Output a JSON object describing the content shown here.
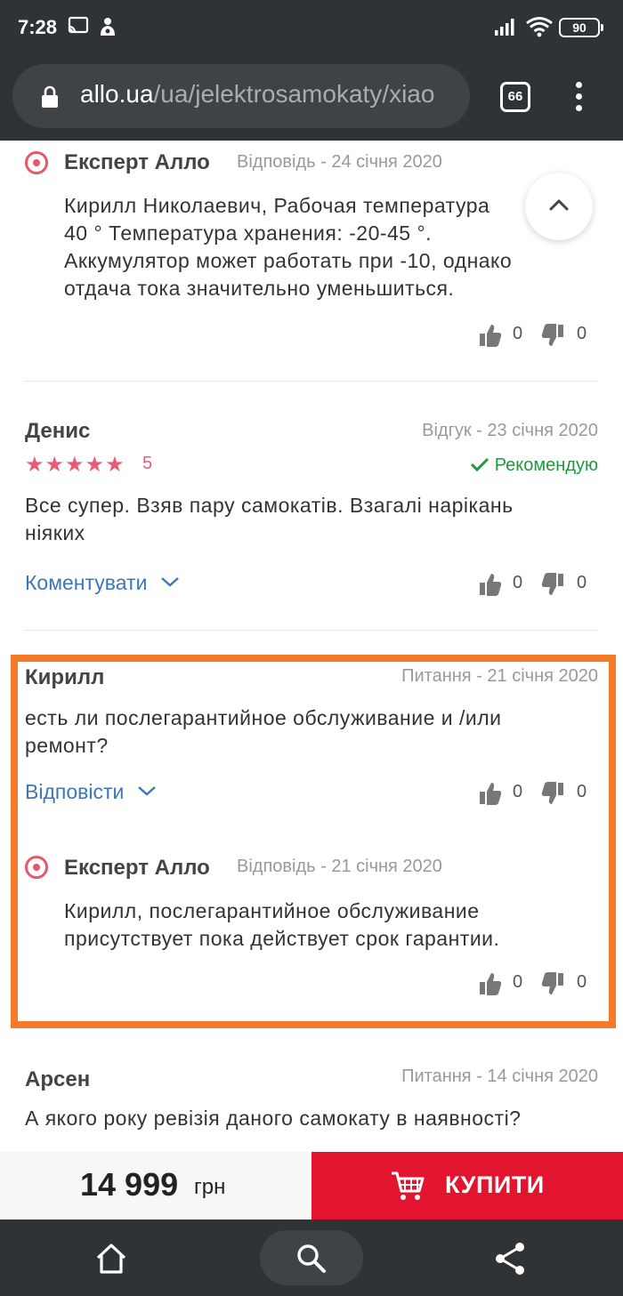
{
  "status_bar": {
    "time": "7:28",
    "battery": "90"
  },
  "browser": {
    "url_host": "allo.ua",
    "url_path": "/ua/jelektrosamokaty/xiao",
    "tab_count": "66"
  },
  "reviews": [
    {
      "expert_name": "Експерт Алло",
      "meta": "Відповідь - 24 січня 2020",
      "text_lines": [
        "Кирилл Николаевич, Рабочая температура",
        "40 ° Температура хранения: -20-45 °.",
        "Аккумулятор может работать при -10, однако",
        "отдача тока значительно уменьшиться."
      ],
      "likes": "0",
      "dislikes": "0"
    },
    {
      "name": "Денис",
      "meta": "Відгук - 23 січня 2020",
      "rating": 5,
      "rating_label": "5",
      "recommend": "Рекомендую",
      "text_lines": [
        "Все супер. Взяв пару самокатів. Взагалі нарікань",
        "ніяких"
      ],
      "action": "Коментувати",
      "likes": "0",
      "dislikes": "0"
    },
    {
      "name": "Кирилл",
      "meta": "Питання - 21 січня 2020",
      "text_lines": [
        "есть ли послегарантийное обслуживание и /или",
        "ремонт?"
      ],
      "action": "Відповісти",
      "likes": "0",
      "dislikes": "0",
      "answer": {
        "expert_name": "Експерт Алло",
        "meta": "Відповідь - 21 січня 2020",
        "text_lines": [
          "Кирилл, послегарантийное обслуживание",
          "присутствует пока действует срок гарантии."
        ],
        "likes": "0",
        "dislikes": "0"
      }
    },
    {
      "name": "Арсен",
      "meta": "Питання - 14 січня 2020",
      "text_lines": [
        "А якого року ревізія даного самокату в наявності?"
      ]
    }
  ],
  "buy_bar": {
    "price": "14 999",
    "currency": "грн",
    "buy_label": "КУПИТИ"
  },
  "colors": {
    "accent_red": "#e3142d",
    "highlight_orange": "#f57b2b",
    "star_pink": "#ea5c73",
    "recommend_green": "#1f9a3b",
    "link_blue": "#3b77b8"
  }
}
